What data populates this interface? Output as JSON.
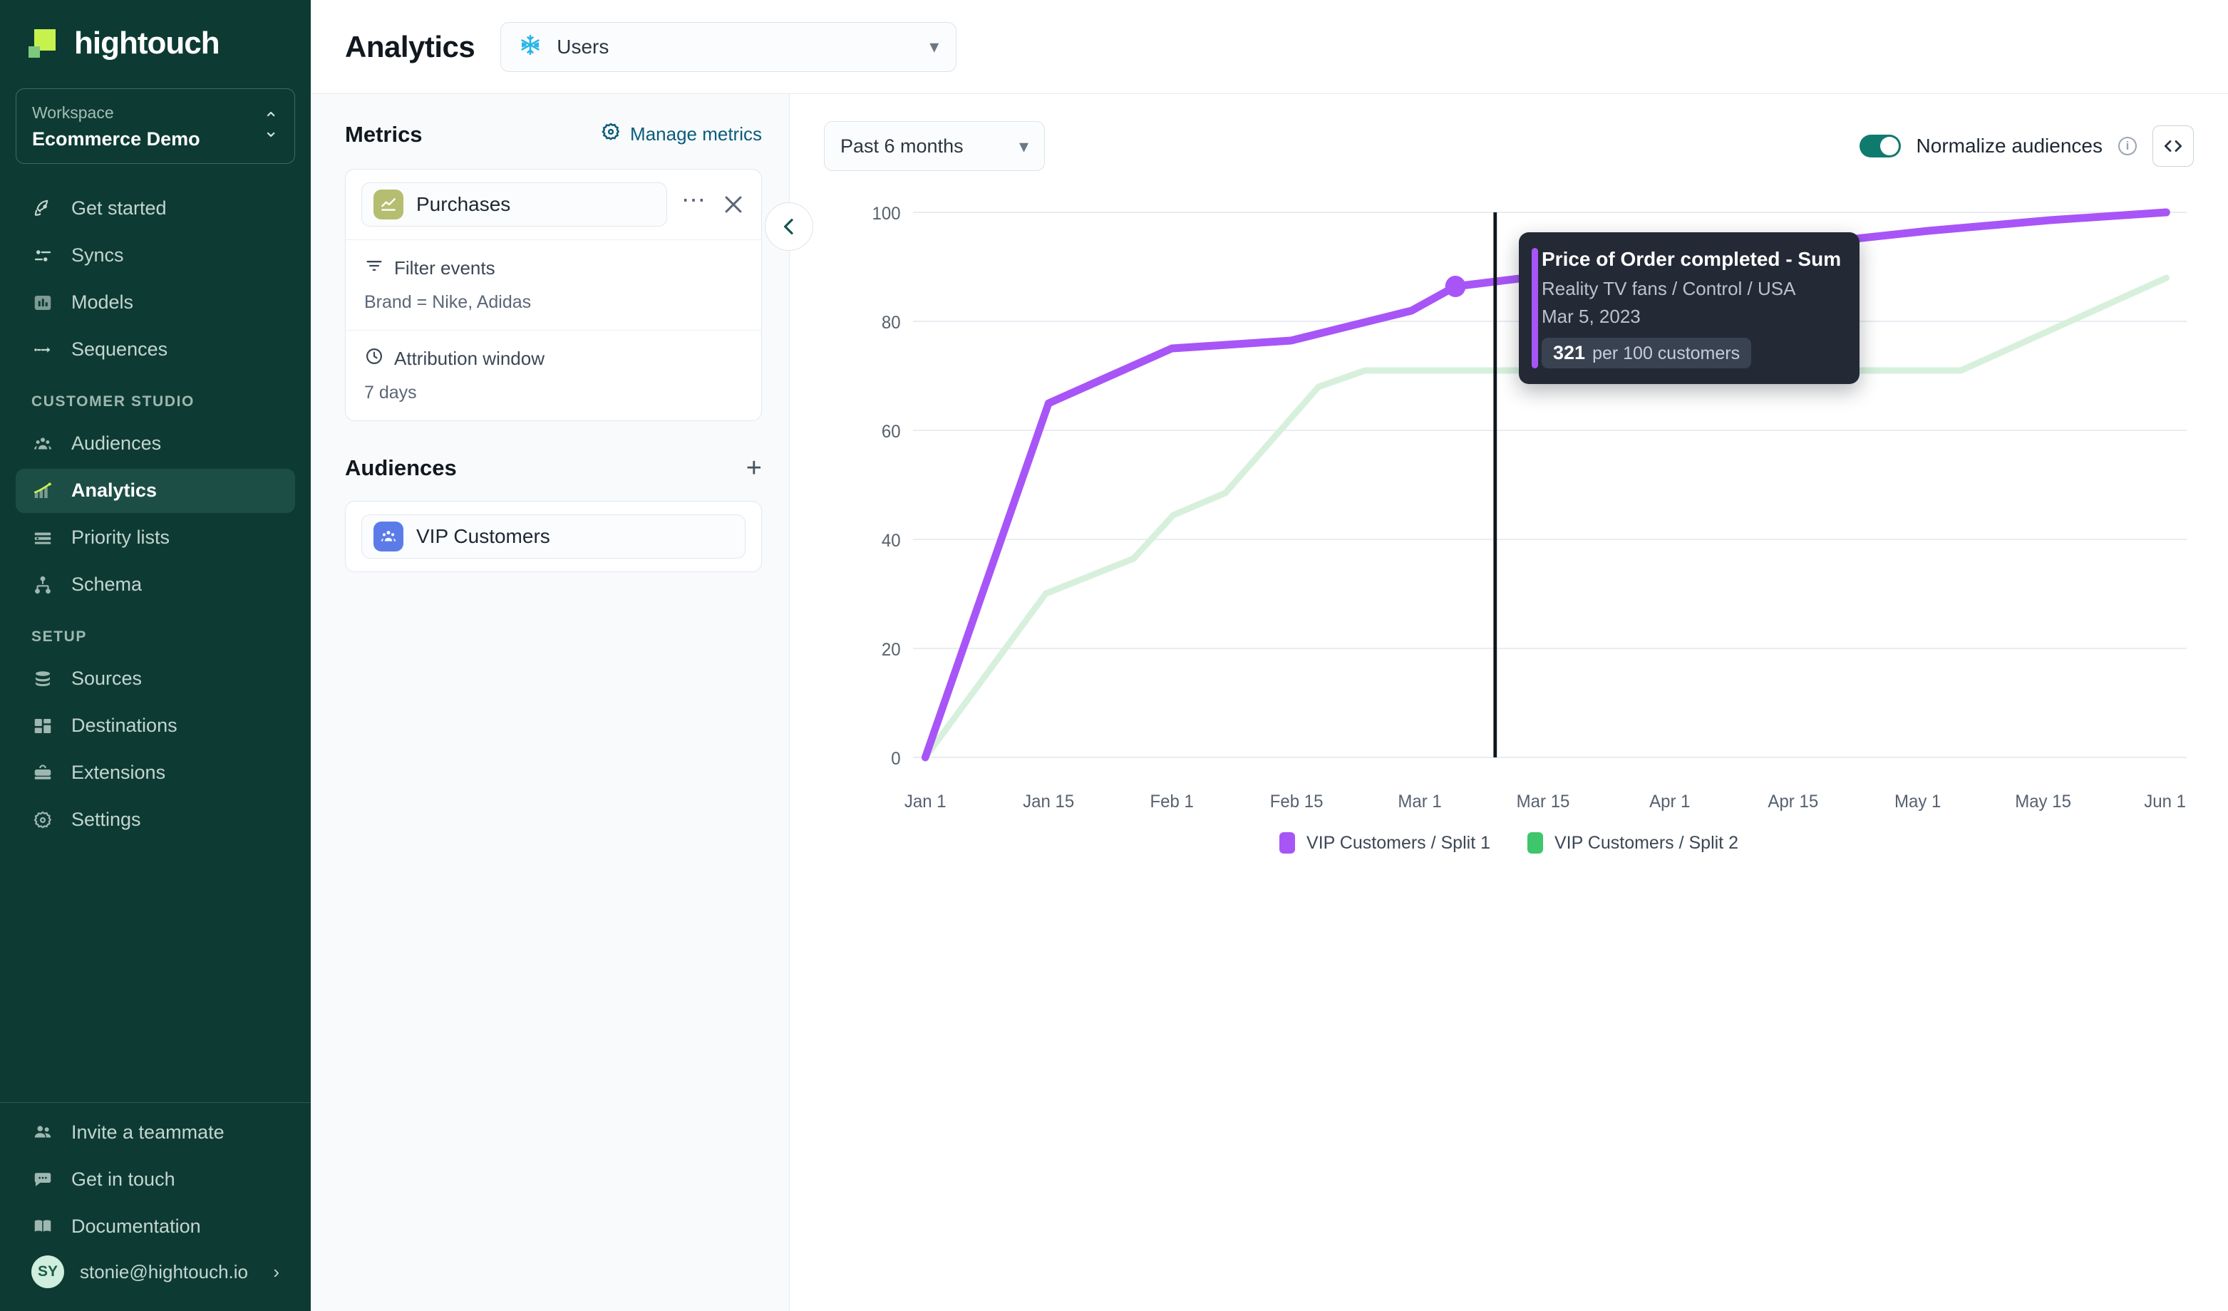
{
  "sidebar": {
    "brand": "hightouch",
    "workspace": {
      "label": "Workspace",
      "value": "Ecommerce Demo"
    },
    "items": [
      {
        "label": "Get started",
        "icon": "rocket-icon"
      },
      {
        "label": "Syncs",
        "icon": "sliders-icon"
      },
      {
        "label": "Models",
        "icon": "bar-chart-icon"
      },
      {
        "label": "Sequences",
        "icon": "arrow-right-icon"
      }
    ],
    "section_customer_studio": "CUSTOMER STUDIO",
    "studio_items": [
      {
        "label": "Audiences",
        "icon": "people-icon"
      },
      {
        "label": "Analytics",
        "icon": "trend-up-icon"
      },
      {
        "label": "Priority lists",
        "icon": "list-icon"
      },
      {
        "label": "Schema",
        "icon": "schema-icon"
      }
    ],
    "section_setup": "SETUP",
    "setup_items": [
      {
        "label": "Sources",
        "icon": "database-icon"
      },
      {
        "label": "Destinations",
        "icon": "grid-icon"
      },
      {
        "label": "Extensions",
        "icon": "briefcase-icon"
      },
      {
        "label": "Settings",
        "icon": "gear-icon"
      }
    ],
    "footer_items": [
      {
        "label": "Invite a teammate",
        "icon": "users-icon"
      },
      {
        "label": "Get in touch",
        "icon": "chat-icon"
      },
      {
        "label": "Documentation",
        "icon": "book-icon"
      }
    ],
    "user": {
      "initials": "SY",
      "email": "stonie@hightouch.io"
    },
    "active_item": "Analytics"
  },
  "topbar": {
    "title": "Analytics",
    "model_select": {
      "value": "Users",
      "icon": "snowflake-icon"
    }
  },
  "config": {
    "metrics_title": "Metrics",
    "manage_metrics": "Manage metrics",
    "metric": {
      "name": "Purchases",
      "filter_label": "Filter events",
      "filter_value": "Brand = Nike, Adidas",
      "attribution_label": "Attribution window",
      "attribution_value": "7 days"
    },
    "audiences_title": "Audiences",
    "audiences": [
      {
        "name": "VIP Customers"
      }
    ]
  },
  "toolbar": {
    "range_value": "Past 6 months",
    "normalize_label": "Normalize audiences",
    "normalize_on": true
  },
  "tooltip": {
    "title": "Price of Order completed - Sum",
    "subtitle": "Reality TV fans / Control / USA",
    "date": "Mar 5, 2023",
    "value": "321",
    "unit": "per 100 customers"
  },
  "colors": {
    "sidebar_bg": "#0d3b33",
    "accent_green": "#c6f24e",
    "teal": "#0f7a6e",
    "link_blue": "#0b5c7a",
    "series1": "#a855f7",
    "series2": "#d6f0dc",
    "legend2": "#3dc66b",
    "snowflake": "#29b5e8"
  },
  "chart_data": {
    "type": "line",
    "title": "",
    "xlabel": "",
    "ylabel": "",
    "ylim": [
      0,
      100
    ],
    "yticks": [
      0,
      20,
      40,
      60,
      80,
      100
    ],
    "xticks": [
      "Jan 1",
      "Jan 15",
      "Feb 1",
      "Feb 15",
      "Mar 1",
      "Mar 15",
      "Apr 1",
      "Apr 15",
      "May 1",
      "May 15",
      "Jun 1"
    ],
    "grid": true,
    "legend_position": "bottom",
    "marker": {
      "series": "VIP Customers / Split 1",
      "x": "Mar 5",
      "y": 86.5
    },
    "vline": {
      "x": "Mar 10",
      "color": "#10161e"
    },
    "series": [
      {
        "name": "VIP Customers / Split 1",
        "color": "#a855f7",
        "points": [
          {
            "x": "Jan 1",
            "y": 0
          },
          {
            "x": "Jan 15",
            "y": 65
          },
          {
            "x": "Feb 1",
            "y": 75
          },
          {
            "x": "Feb 15",
            "y": 76.5
          },
          {
            "x": "Mar 1",
            "y": 82
          },
          {
            "x": "Mar 5",
            "y": 86.5
          },
          {
            "x": "Apr 1",
            "y": 91.5
          },
          {
            "x": "Apr 15",
            "y": 94
          },
          {
            "x": "May 1",
            "y": 96.5
          },
          {
            "x": "May 15",
            "y": 98.5
          },
          {
            "x": "Jun 1",
            "y": 100
          }
        ]
      },
      {
        "name": "VIP Customers / Split 2",
        "color": "#d6f0dc",
        "points": [
          {
            "x": "Jan 1",
            "y": 0
          },
          {
            "x": "Jan 22",
            "y": 30
          },
          {
            "x": "Feb 8",
            "y": 36.5
          },
          {
            "x": "Feb 15",
            "y": 44.5
          },
          {
            "x": "Feb 25",
            "y": 48.5
          },
          {
            "x": "Mar 12",
            "y": 68
          },
          {
            "x": "Mar 20",
            "y": 71
          },
          {
            "x": "May 15",
            "y": 71
          },
          {
            "x": "Jun 1",
            "y": 88
          }
        ]
      }
    ],
    "legend": [
      {
        "label": "VIP Customers / Split 1",
        "color": "#a855f7"
      },
      {
        "label": "VIP Customers / Split 2",
        "color": "#3dc66b"
      }
    ]
  }
}
